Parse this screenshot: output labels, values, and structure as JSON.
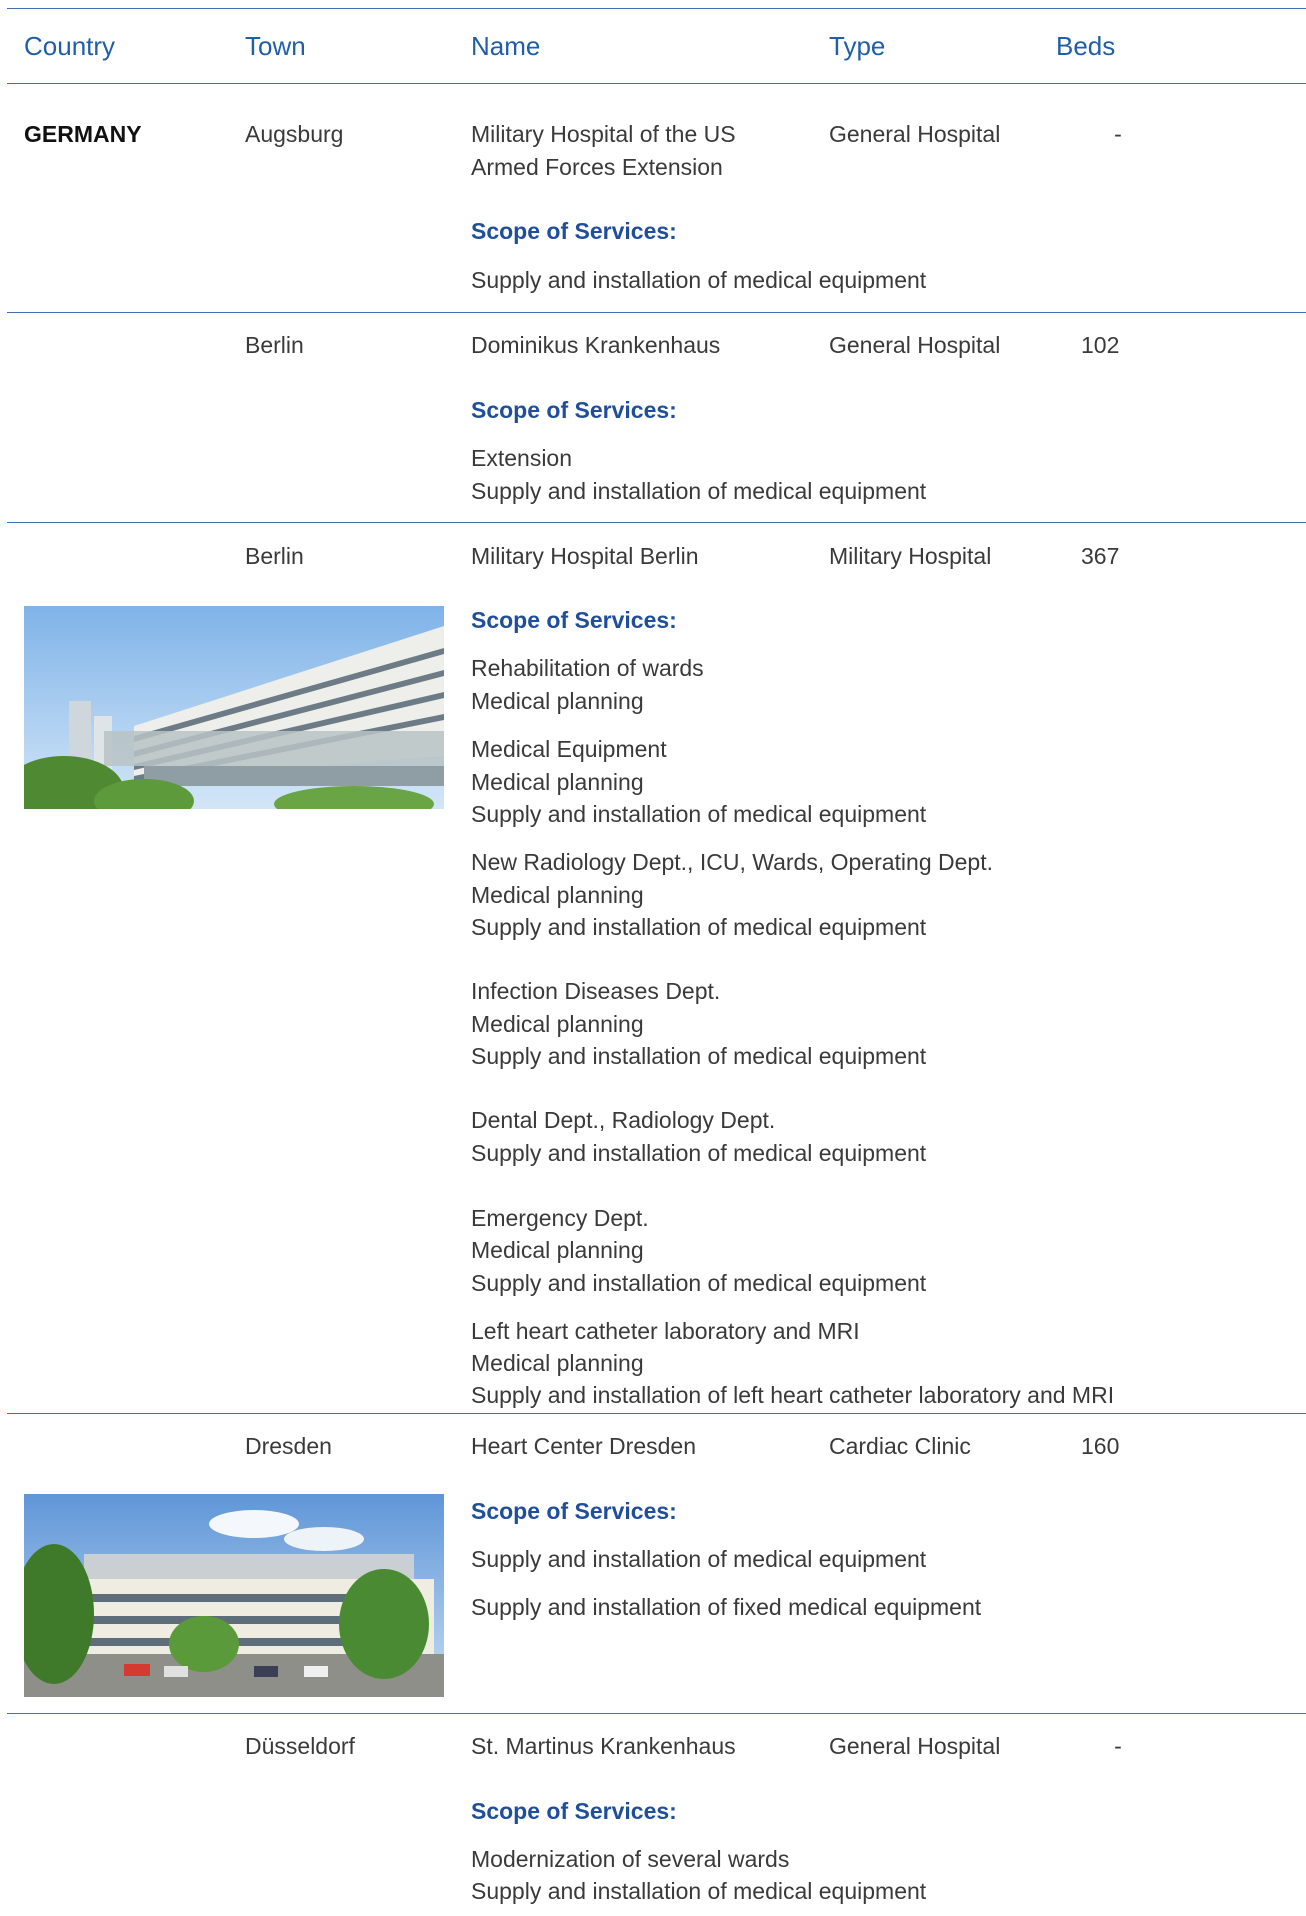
{
  "header": {
    "country": "Country",
    "town": "Town",
    "name": "Name",
    "type": "Type",
    "beds": "Beds"
  },
  "entries": [
    {
      "country": "GERMANY",
      "town": "Augsburg",
      "name_lines": [
        "Military Hospital of the US",
        "Armed Forces Extension"
      ],
      "type": "General Hospital",
      "beds": "-",
      "scope_label": "Scope of Services:",
      "scope": [
        "Supply and installation of medical equipment"
      ]
    },
    {
      "town": "Berlin",
      "name_lines": [
        "Dominikus Krankenhaus"
      ],
      "type": "General Hospital",
      "beds": "102",
      "scope_label": "Scope of Services:",
      "scope": [
        "Extension",
        "Supply and installation of medical equipment"
      ]
    },
    {
      "town": "Berlin",
      "name_lines": [
        "Military Hospital Berlin"
      ],
      "type": "Military Hospital",
      "beds": "367",
      "scope_label": "Scope of Services:",
      "scope": [
        "Rehabilitation of wards",
        "Medical planning",
        "Medical Equipment",
        "Medical planning",
        "Supply and installation of medical equipment",
        "New Radiology Dept., ICU, Wards, Operating Dept.",
        "Medical planning",
        "Supply and installation of medical equipment",
        "Infection Diseases Dept.",
        "Medical planning",
        "Supply and installation of medical equipment",
        "Dental Dept., Radiology Dept.",
        "Supply and installation of medical equipment",
        "Emergency Dept.",
        "Medical planning",
        "Supply and installation of medical equipment",
        "Left heart catheter laboratory and MRI",
        "Medical planning",
        "Supply and installation of left heart catheter laboratory and MRI"
      ]
    },
    {
      "town": "Dresden",
      "name_lines": [
        "Heart Center Dresden"
      ],
      "type": "Cardiac Clinic",
      "beds": "160",
      "scope_label": "Scope of Services:",
      "scope": [
        "Supply and installation of medical equipment",
        "Supply and installation of fixed medical equipment"
      ]
    },
    {
      "town": "Düsseldorf",
      "name_lines": [
        "St. Martinus Krankenhaus"
      ],
      "type": "General Hospital",
      "beds": "-",
      "scope_label": "Scope of Services:",
      "scope": [
        "Modernization of several wards",
        "Supply and installation of medical equipment"
      ]
    }
  ],
  "colors": {
    "accent": "#1f5fa8",
    "rule": "#3b73b0",
    "text": "#3a3a3a"
  },
  "images": [
    "hospital-building-photo",
    "hospital-building-photo"
  ]
}
